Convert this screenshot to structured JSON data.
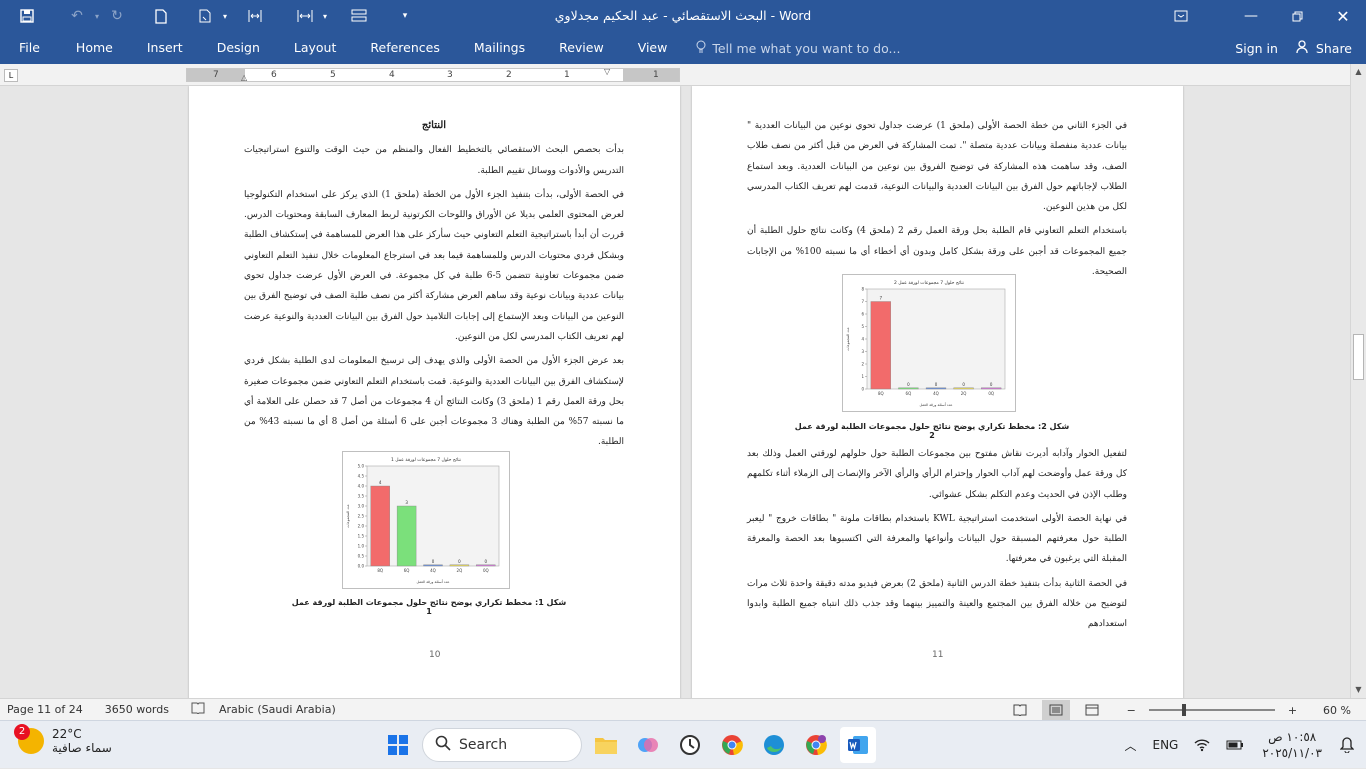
{
  "window": {
    "title": "البحث الاستقصائي - عبد الحكيم مجدلاوي  -  Word"
  },
  "ribbon": {
    "tabs": [
      "File",
      "Home",
      "Insert",
      "Design",
      "Layout",
      "References",
      "Mailings",
      "Review",
      "View"
    ],
    "tell_me_placeholder": "Tell me what you want to do...",
    "sign_in": "Sign in",
    "share": "Share"
  },
  "ruler": {
    "numbers": [
      "7",
      "6",
      "5",
      "4",
      "3",
      "2",
      "1",
      "1"
    ]
  },
  "page_left": {
    "heading": "النتائج",
    "paragraphs": [
      "بدأت بحصص البحث الاستقصائي بالتخطيط الفعال والمنظم من حيث الوقت والتنوع استراتيجيات التدريس والأدوات ووسائل تقييم الطلبة.",
      "في الحصة الأولى، بدأت بتنفيذ الجزء الأول من الخطة (ملحق 1) الذي يركز على استخدام التكنولوجيا لعرض المحتوى العلمي بديلا عن الأوراق واللوحات الكرتونية لربط المعارف السابقة ومحتويات الدرس. قررت أن أبدأ باستراتيجية التعلم التعاوني حيث سأركز على هذا العرض للمساهمة في إستكشاف الطلبة وبشكل فردي محتويات الدرس وللمساهمة فيما بعد في استرجاع المعلومات خلال تنفيذ التعلم التعاوني ضمن مجموعات تعاونية تتضمن 5-6 طلبة في كل مجموعة. في العرض الأول عرضت جداول تحوي بيانات عددية وبيانات نوعية وقد ساهم العرض مشاركة أكثر من نصف طلبة الصف في توضيح الفرق بين النوعين من البيانات وبعد الإستماع إلى إجابات التلاميذ حول الفرق بين البيانات العددية والنوعية عرضت لهم تعريف الكتاب المدرسي لكل من النوعين.",
      "بعد عرض الجزء الأول من الحصة الأولى والذي يهدف إلى ترسيخ المعلومات لدى الطلبة بشكل فردي لإستكشاف الفرق بين البيانات العددية والنوعية. قمت باستخدام التعلم التعاوني ضمن مجموعات صغيرة بحل ورقة العمل رقم 1 (ملحق 3) وكانت النتائج أن 4 مجموعات من أصل 7 قد حصلن على العلامة أي ما نسبته 57% من الطلبة وهناك 3 مجموعات أجبن على 6 أسئلة من أصل 8 أي ما نسبته 43% من الطلبة."
    ],
    "caption": "شكل 1: مخطط تكراري يوضح نتائج حلول مجموعات الطلبة لورقة عمل 1",
    "page_number": "10"
  },
  "page_right": {
    "paragraphs_top": [
      "في الجزء الثاني من خطة الحصة الأولى (ملحق 1) عرضت جداول تحوي نوعين من البيانات العددية \" بيانات عددية منفصلة وبيانات عددية متصلة \". تمت المشاركة في العرض من قبل أكثر من نصف طلاب الصف، وقد ساهمت هذه المشاركة في توضيح الفروق بين نوعين من البيانات العددية. وبعد استماع الطلاب لإجاباتهم حول الفرق بين البيانات العددية والبيانات النوعية، قدمت لهم تعريف الكتاب المدرسي لكل من هذين النوعين.",
      "باستخدام التعلم التعاوني قام الطلبة بحل ورقة العمل رقم 2 (ملحق 4) وكانت نتائج حلول الطلبة أن جميع المجموعات قد أجبن على ورقة بشكل كامل وبدون أي أخطاء أي ما نسبته 100% من الإجابات الصحيحة."
    ],
    "caption": "شكل 2: مخطط تكراري يوضح نتائج حلول مجموعات الطلبة لورقة عمل 2",
    "paragraphs_bottom": [
      "لتفعيل الحوار وآدابه أديرت نقاش مفتوح بين مجموعات الطلبة حول حلولهم لورقتي العمل وذلك بعد كل ورقة عمل وأوضحت لهم آداب الحوار وإحترام الرأي والرأي الآخر والإنصات إلى الزملاء أثناء تكلمهم وطلب الإذن في الحديث وعدم التكلم بشكل عشوائي.",
      "في نهاية الحصة الأولى استخدمت استراتيجية KWL باستخدام بطاقات ملونة \" بطاقات خروج \" ليعبر الطلبة حول معرفتهم المسبقة حول البيانات وأنواعها والمعرفة التي اكتسبوها بعد الحصة والمعرفة المقبلة التي يرغبون في معرفتها.",
      "في الحصة الثانية بدأت بتنفيذ خطة الدرس الثانية (ملحق 2) بعرض فيديو مدته دقيقة واحدة ثلاث مرات لتوضيح من خلاله الفرق بين المجتمع والعينة والتمييز بينهما وقد جذب ذلك انتباه جميع الطلبة وابدوا استعدادهم"
    ],
    "page_number": "11"
  },
  "chart_data": [
    {
      "type": "bar",
      "title": "نتائج حلول 7 مجموعات لورقة عمل 1",
      "xlabel": "عدد أسئلة ورقة العمل",
      "ylabel": "عدد المجموعات",
      "categories": [
        "8Q",
        "6Q",
        "4Q",
        "2Q",
        "0Q"
      ],
      "values": [
        4,
        3,
        0,
        0,
        0
      ],
      "colors": [
        "#f26b6b",
        "#7be07b",
        "#6c8fd8",
        "#e8d85a",
        "#d27ad6"
      ],
      "ylim": [
        0,
        5
      ],
      "yticks": [
        "0.0",
        "0.5",
        "1.0",
        "1.5",
        "2.0",
        "2.5",
        "3.0",
        "3.5",
        "4.0",
        "4.5",
        "5.0"
      ],
      "data_labels": [
        "4",
        "3",
        "0",
        "0",
        "0"
      ]
    },
    {
      "type": "bar",
      "title": "نتائج حلول 7 مجموعات لورقة عمل 2",
      "xlabel": "عدد أسئلة ورقة العمل",
      "ylabel": "عدد المجموعات",
      "categories": [
        "8Q",
        "6Q",
        "4Q",
        "2Q",
        "0Q"
      ],
      "values": [
        7,
        0,
        0,
        0,
        0
      ],
      "colors": [
        "#f26b6b",
        "#7be07b",
        "#6c8fd8",
        "#e8d85a",
        "#d27ad6"
      ],
      "ylim": [
        0,
        8
      ],
      "yticks": [
        "0",
        "1",
        "2",
        "3",
        "4",
        "5",
        "6",
        "7",
        "8"
      ],
      "data_labels": [
        "7",
        "0",
        "0",
        "0",
        "0"
      ]
    }
  ],
  "status": {
    "page": "Page 11 of 24",
    "words": "3650 words",
    "language": "Arabic (Saudi Arabia)",
    "zoom": "60 %",
    "zoom_level": 0.6
  },
  "taskbar": {
    "weather_badge": "2",
    "temperature": "22°C",
    "condition": "سماء صافية",
    "search_label": "Search",
    "language": "ENG",
    "time": "١٠:٥٨ ص",
    "date": "٢٠٢٥/١١/٠٣"
  }
}
